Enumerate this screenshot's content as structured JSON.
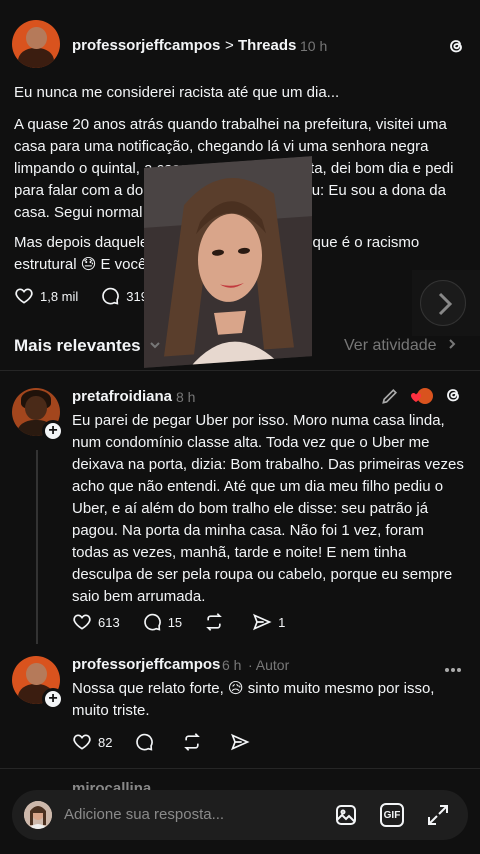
{
  "post": {
    "username": "professorjeffcampos",
    "breadcrumb_sep": ">",
    "breadcrumb_target": "Threads",
    "time": "10 h",
    "paragraphs": [
      "Eu nunca me considerei racista até que um dia...",
      "A quase 20 anos atrás quando trabalhei na prefeitura, visitei uma casa para uma notificação, chegando lá vi uma senhora negra limpando o quintal, a casa era grande e bonita, dei bom dia e pedi para falar com a dona da casa, ela respondeu: Eu sou a dona da casa. Segui normal e continuei o trabalho...",
      "Mas depois daquele dia entendi na prática o que é o racismo estrutural 😓 E você já viveu algo assim?"
    ],
    "likes": "1,8 mil",
    "comments": "319"
  },
  "sort": {
    "label": "Mais relevantes",
    "activity_link": "Ver atividade"
  },
  "replies": [
    {
      "username": "pretafroidiana",
      "time": "8 h",
      "text": "Eu parei de pegar Uber por isso. Moro numa casa linda, num condomínio classe alta. Toda vez que o Uber me deixava na porta, dizia: Bom trabalho.  Das primeiras vezes acho que não entendi. Até que um dia meu filho pediu o Uber, e aí além do bom tralho ele disse: seu patrão já pagou. Na porta da minha casa. Não foi 1 vez, foram todas as vezes,  manhã, tarde e noite! E nem tinha desculpa de ser pela roupa ou cabelo, porque eu sempre saio bem arrumada.",
      "likes": "613",
      "comments": "15",
      "shares": "1"
    },
    {
      "username": "professorjeffcampos",
      "time": "6 h",
      "author_badge": "· Autor",
      "text": "Nossa que relato forte, 😥 sinto muito mesmo por isso, muito triste.",
      "likes": "82"
    }
  ],
  "next_reply_username": "mirocallina",
  "composer": {
    "placeholder": "Adicione sua resposta...",
    "gif_label": "GIF"
  },
  "colors": {
    "background": "#101010",
    "text": "#f3f5f7",
    "muted": "#777777",
    "like_red": "#ff3040"
  }
}
